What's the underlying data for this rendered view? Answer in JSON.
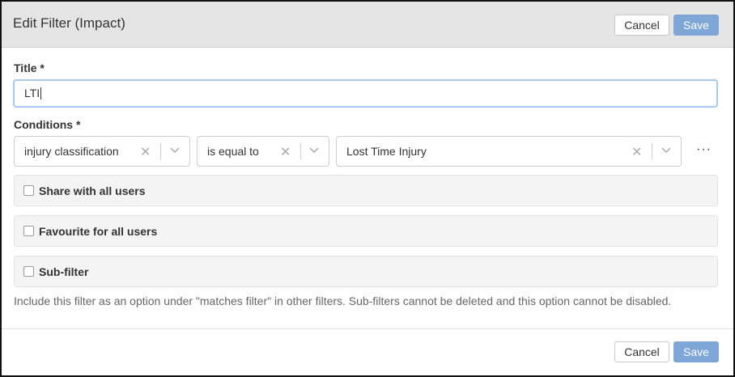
{
  "dialog": {
    "title": "Edit Filter (Impact)",
    "cancel_label": "Cancel",
    "save_label": "Save"
  },
  "form": {
    "title_label": "Title *",
    "title_value": "LTI",
    "conditions_label": "Conditions *",
    "conditions": [
      {
        "field": "injury classification",
        "operator": "is equal to",
        "value": "Lost Time Injury"
      }
    ],
    "more_label": "···",
    "options": [
      {
        "label": "Share with all users",
        "checked": false
      },
      {
        "label": "Favourite for all users",
        "checked": false
      },
      {
        "label": "Sub-filter",
        "checked": false
      }
    ],
    "subfilter_help": "Include this filter as an option under \"matches filter\" in other filters. Sub-filters cannot be deleted and this option cannot be disabled."
  },
  "colors": {
    "accent": "#7ea6d6",
    "header_bg": "#e5e5e5",
    "input_focus_border": "#a9c8ee"
  },
  "icons": [
    "clear-icon",
    "chevron-down-icon",
    "more-icon",
    "checkbox-icon"
  ]
}
